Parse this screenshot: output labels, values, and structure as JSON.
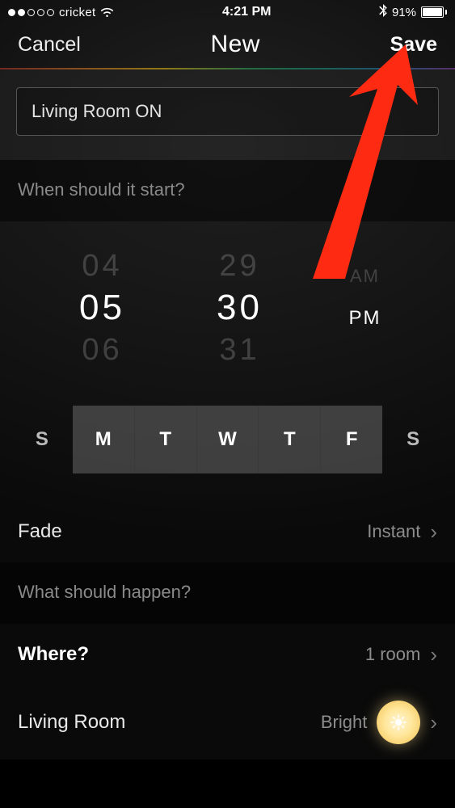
{
  "status": {
    "carrier": "cricket",
    "time": "4:21 PM",
    "battery_pct": "91%",
    "battery_fill_pct": 91
  },
  "nav": {
    "cancel": "Cancel",
    "title": "New",
    "save": "Save"
  },
  "input": {
    "name_value": "Living Room ON"
  },
  "sections": {
    "start_header": "When should it start?",
    "happen_header": "What should happen?"
  },
  "picker": {
    "hour_prev": "04",
    "hour_sel": "05",
    "hour_next": "06",
    "min_prev": "29",
    "min_sel": "30",
    "min_next": "31",
    "ampm_prev": "AM",
    "ampm_sel": "PM"
  },
  "days": [
    {
      "label": "S",
      "selected": false
    },
    {
      "label": "M",
      "selected": true
    },
    {
      "label": "T",
      "selected": true
    },
    {
      "label": "W",
      "selected": true
    },
    {
      "label": "T",
      "selected": true
    },
    {
      "label": "F",
      "selected": true
    },
    {
      "label": "S",
      "selected": false
    }
  ],
  "rows": {
    "fade_label": "Fade",
    "fade_value": "Instant",
    "where_label": "Where?",
    "where_value": "1 room",
    "room_label": "Living Room",
    "room_value": "Bright"
  }
}
